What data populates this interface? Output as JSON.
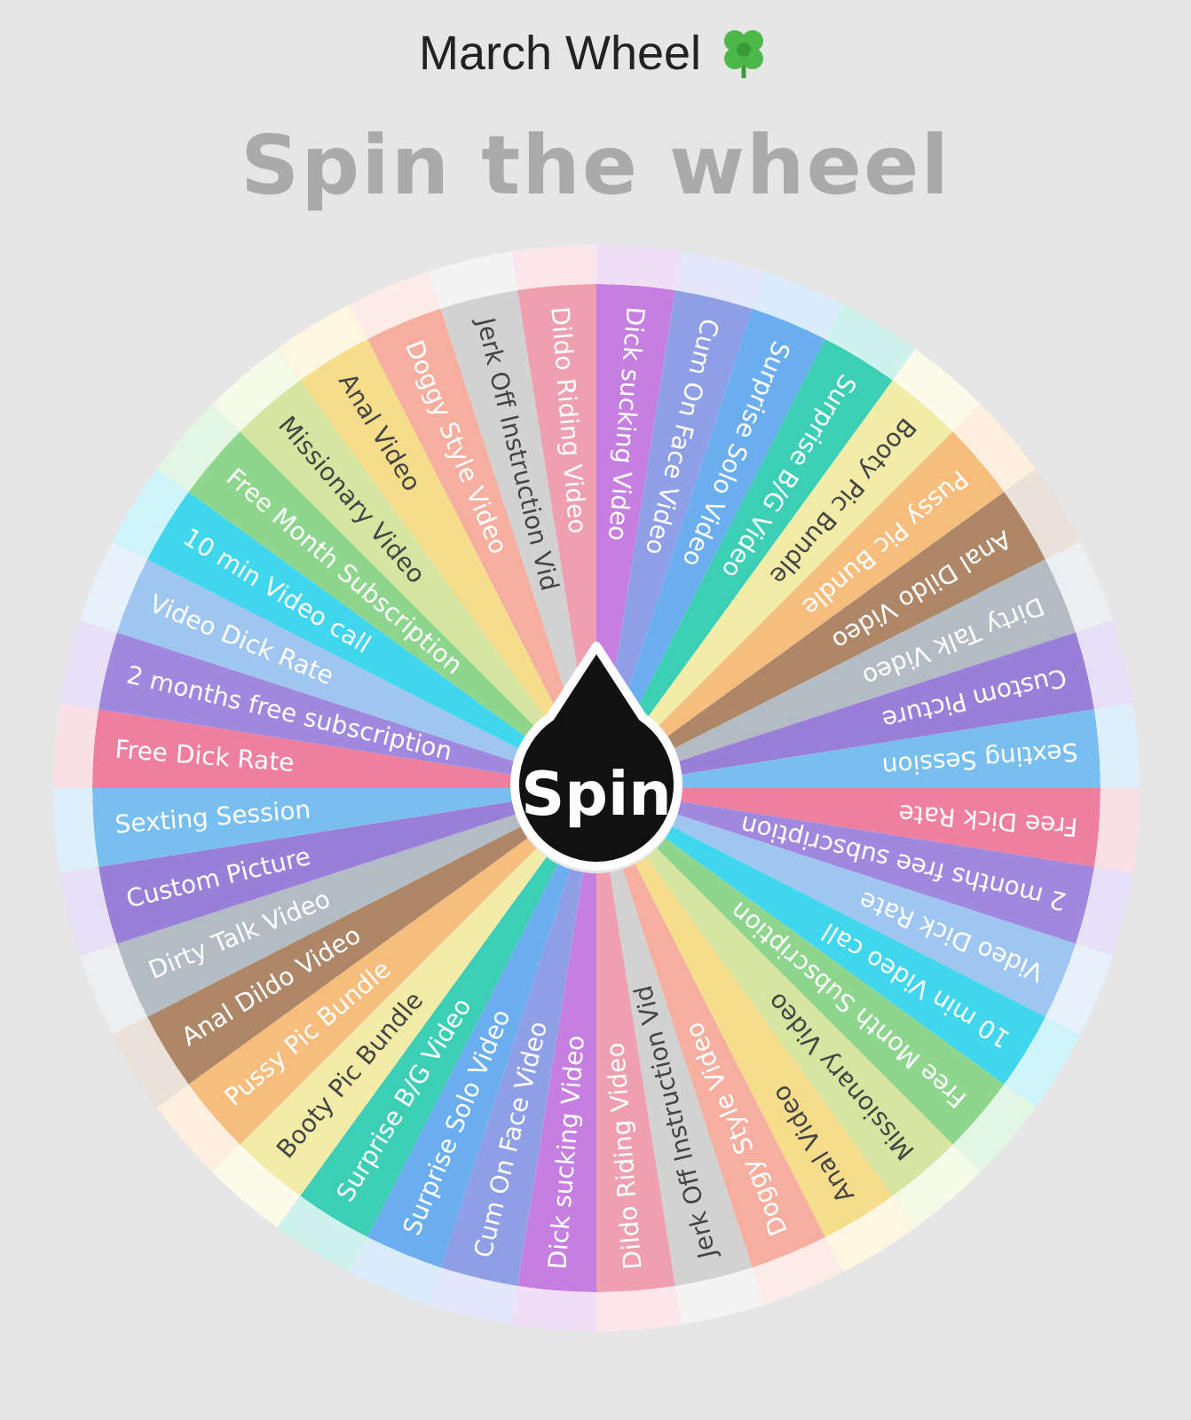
{
  "title": "March Wheel",
  "heading": "Spin the wheel",
  "spin_button": "Spin",
  "segments": [
    {
      "label": "Dick sucking Video",
      "color": "#c67ee0"
    },
    {
      "label": "Cum On Face Video",
      "color": "#8f9fe6"
    },
    {
      "label": "Surprise Solo Video",
      "color": "#6aaef0"
    },
    {
      "label": "Surprise B/G Video",
      "color": "#3ccfb6"
    },
    {
      "label": "Booty Pic Bundle",
      "color": "#f2eca8"
    },
    {
      "label": "Pussy Pic Bundle",
      "color": "#f6bd7c"
    },
    {
      "label": "Anal Dildo Video",
      "color": "#ad8768"
    },
    {
      "label": "Dirty Talk Video",
      "color": "#b3bcc4"
    },
    {
      "label": "Custom Picture",
      "color": "#9a7fd8"
    },
    {
      "label": "Sexting Session",
      "color": "#78bff0"
    },
    {
      "label": "Free Dick Rate",
      "color": "#ee7f9e"
    },
    {
      "label": "2 months free subscription",
      "color": "#a088df"
    },
    {
      "label": "Video Dick Rate",
      "color": "#9ec6f0"
    },
    {
      "label": "10 min Video call",
      "color": "#3fd6ee"
    },
    {
      "label": "Free Month Subscription",
      "color": "#8ed68e"
    },
    {
      "label": "Missionary Video",
      "color": "#d6e6a0"
    },
    {
      "label": "Anal Video",
      "color": "#f6dd8c"
    },
    {
      "label": "Doggy Style Video",
      "color": "#f6ae9e"
    },
    {
      "label": "Jerk Off Instruction Vid",
      "color": "#d2d2d2"
    },
    {
      "label": "Dildo Riding Video",
      "color": "#ee9fb0"
    },
    {
      "label": "Dick sucking Video",
      "color": "#c67ee0"
    },
    {
      "label": "Cum On Face Video",
      "color": "#8f9fe6"
    },
    {
      "label": "Surprise Solo Video",
      "color": "#6aaef0"
    },
    {
      "label": "Surprise B/G Video",
      "color": "#3ccfb6"
    },
    {
      "label": "Booty Pic Bundle",
      "color": "#f2eca8"
    },
    {
      "label": "Pussy Pic Bundle",
      "color": "#f6bd7c"
    },
    {
      "label": "Anal Dildo Video",
      "color": "#ad8768"
    },
    {
      "label": "Dirty Talk Video",
      "color": "#b3bcc4"
    },
    {
      "label": "Custom Picture",
      "color": "#9a7fd8"
    },
    {
      "label": "Sexting Session",
      "color": "#78bff0"
    },
    {
      "label": "Free Dick Rate",
      "color": "#ee7f9e"
    },
    {
      "label": "2 months free subscription",
      "color": "#a088df"
    },
    {
      "label": "Video Dick Rate",
      "color": "#9ec6f0"
    },
    {
      "label": "10 min Video call",
      "color": "#3fd6ee"
    },
    {
      "label": "Free Month Subscription",
      "color": "#8ed68e"
    },
    {
      "label": "Missionary Video",
      "color": "#d6e6a0"
    },
    {
      "label": "Anal Video",
      "color": "#f6dd8c"
    },
    {
      "label": "Doggy Style Video",
      "color": "#f6ae9e"
    },
    {
      "label": "Jerk Off Instruction Vid",
      "color": "#d2d2d2"
    },
    {
      "label": "Dildo Riding Video",
      "color": "#ee9fb0"
    }
  ]
}
